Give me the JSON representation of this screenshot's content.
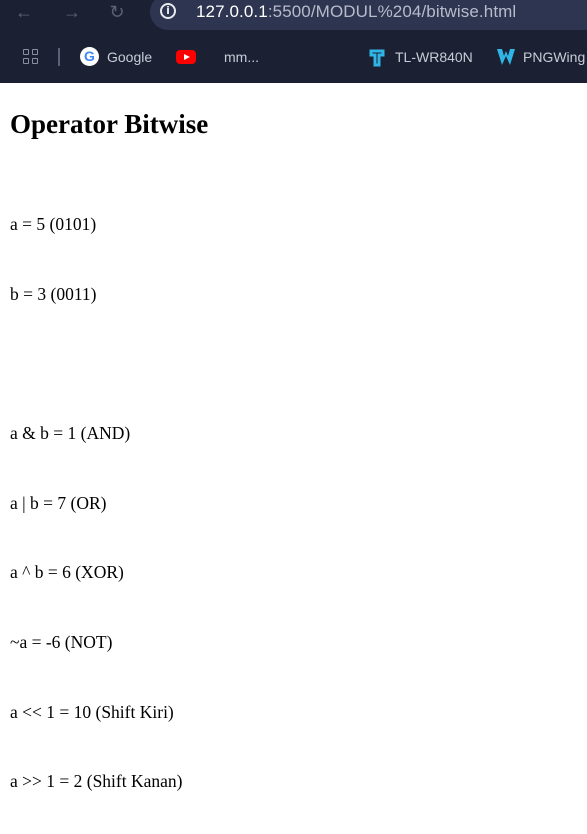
{
  "browser": {
    "nav": {
      "back_glyph": "←",
      "forward_glyph": "→",
      "reload_glyph": "↻"
    },
    "address_bar": {
      "info_icon": "info-icon",
      "host": "127.0.0.1",
      "path": ":5500/MODUL%204/bitwise.html"
    },
    "bookmarks": [
      {
        "label": "",
        "icon": "apps-grid-icon"
      },
      {
        "label": "Google",
        "icon": "google-icon"
      },
      {
        "label": "mm...",
        "icon": "youtube-icon"
      },
      {
        "label": "TL-WR840N",
        "icon": "tplink-icon"
      },
      {
        "label": "PNGWing",
        "icon": "pngwing-icon"
      }
    ],
    "colors": {
      "chrome_bg": "#1c2033",
      "omnibox_bg": "#2e3550",
      "youtube_red": "#ff0000",
      "tplink_blue": "#2fb6e6"
    }
  },
  "page": {
    "title": "Operator Bitwise",
    "lines": [
      "a = 5 (0101)",
      "b = 3 (0011)",
      "",
      "a & b = 1 (AND)",
      "a | b = 7 (OR)",
      "a ^ b = 6 (XOR)",
      "~a = -6 (NOT)",
      "a << 1 = 10 (Shift Kiri)",
      "a >> 1 = 2 (Shift Kanan)"
    ]
  }
}
